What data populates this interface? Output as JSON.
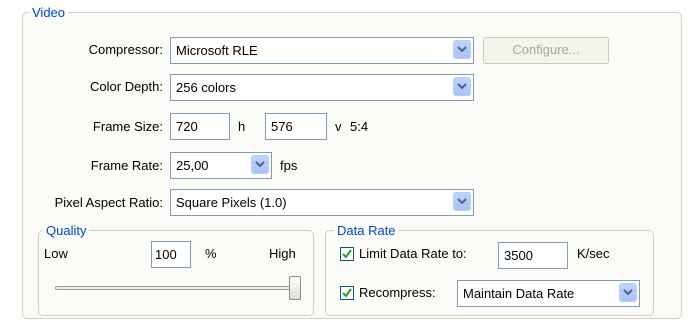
{
  "video": {
    "legend": "Video",
    "compressor": {
      "label": "Compressor:",
      "value": "Microsoft RLE",
      "configure_label": "Configure..."
    },
    "color_depth": {
      "label": "Color Depth:",
      "value": "256 colors"
    },
    "frame_size": {
      "label": "Frame Size:",
      "width": "720",
      "h_label": "h",
      "height": "576",
      "v_label": "v",
      "ratio": "5:4"
    },
    "frame_rate": {
      "label": "Frame Rate:",
      "value": "25,00",
      "unit": "fps"
    },
    "pixel_aspect": {
      "label": "Pixel Aspect Ratio:",
      "value": "Square Pixels (1.0)"
    }
  },
  "quality": {
    "legend": "Quality",
    "low_label": "Low",
    "value": "100",
    "unit": "%",
    "high_label": "High",
    "slider_level": 1.0
  },
  "data_rate": {
    "legend": "Data Rate",
    "limit_label": "Limit Data Rate to:",
    "limit_checked": true,
    "limit_value": "3500",
    "limit_unit": "K/sec",
    "recompress_label": "Recompress:",
    "recompress_checked": true,
    "recompress_mode": "Maintain Data Rate"
  },
  "colors": {
    "legend": "#0046d5",
    "border": "#d0d0bf",
    "field_border": "#7f9db9"
  }
}
